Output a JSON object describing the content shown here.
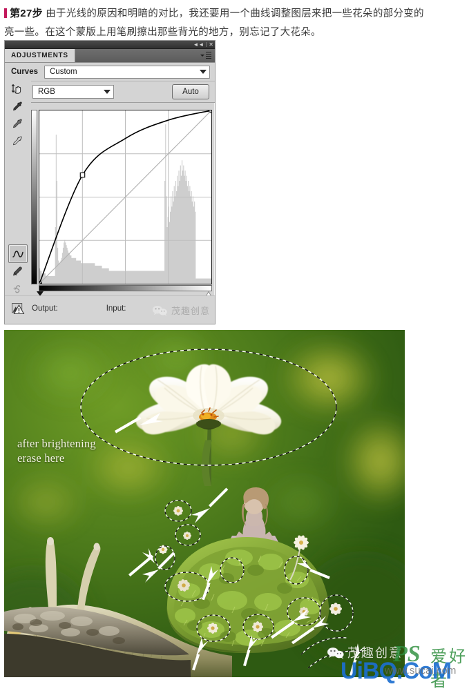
{
  "tutorial": {
    "step_label": "第27步",
    "line1": "由于光线的原因和明暗的对比，我还要用一个曲线调整图层来把一些花朵的部分变的",
    "line2": "亮一些。在这个蒙版上用笔刷擦出那些背光的地方，别忘记了大花朵。"
  },
  "panel": {
    "titlebar": {
      "collapse": "◄◄",
      "close": "✕"
    },
    "tab_label": "ADJUSTMENTS",
    "curves_label": "Curves",
    "preset_value": "Custom",
    "channel_value": "RGB",
    "auto_label": "Auto",
    "output_label": "Output:",
    "input_label": "Input:",
    "output_value": "",
    "input_value": "",
    "watermark": "茂趣创意",
    "tools": [
      {
        "name": "targeted-adjustment-tool",
        "selected": false
      },
      {
        "name": "black-point-eyedropper",
        "selected": false
      },
      {
        "name": "gray-point-eyedropper",
        "selected": false
      },
      {
        "name": "white-point-eyedropper",
        "selected": false
      },
      {
        "name": "curve-point-tool",
        "selected": true
      },
      {
        "name": "pencil-draw-tool",
        "selected": false
      },
      {
        "name": "smooth-curve-tool",
        "selected": false
      }
    ]
  },
  "chart_data": {
    "type": "line",
    "title": "RGB Curve",
    "xlabel": "Input",
    "ylabel": "Output",
    "xlim": [
      0,
      255
    ],
    "ylim": [
      0,
      255
    ],
    "grid": true,
    "grid_divisions": 4,
    "series": [
      {
        "name": "RGB curve",
        "points": [
          [
            0,
            0
          ],
          [
            64,
            160
          ],
          [
            128,
            214
          ],
          [
            192,
            241
          ],
          [
            255,
            255
          ]
        ],
        "control_points": [
          [
            0,
            0
          ],
          [
            64,
            160
          ],
          [
            255,
            255
          ]
        ],
        "color": "#000000"
      },
      {
        "name": "baseline diagonal",
        "points": [
          [
            0,
            0
          ],
          [
            255,
            255
          ]
        ],
        "color": "#b4b4b4"
      }
    ],
    "histogram": {
      "name": "image histogram",
      "color": "#c9c9c9",
      "bins": [
        6,
        5,
        5,
        4,
        4,
        4,
        4,
        4,
        3,
        3,
        3,
        3,
        3,
        3,
        3,
        3,
        3,
        3,
        3,
        3,
        22,
        58,
        40,
        14,
        9,
        8,
        8,
        9,
        10,
        12,
        14,
        16,
        17,
        16,
        15,
        14,
        13,
        12,
        12,
        11,
        11,
        10,
        10,
        10,
        10,
        10,
        10,
        9,
        9,
        9,
        9,
        9,
        9,
        8,
        8,
        8,
        8,
        8,
        8,
        8,
        8,
        8,
        8,
        8,
        8,
        8,
        8,
        8,
        8,
        8,
        8,
        7,
        7,
        7,
        7,
        7,
        7,
        7,
        7,
        7,
        6,
        6,
        6,
        6,
        6,
        6,
        6,
        6,
        6,
        5,
        5,
        5,
        5,
        5,
        5,
        5,
        5,
        5,
        5,
        5,
        5,
        5,
        5,
        5,
        5,
        5,
        5,
        5,
        5,
        5,
        5,
        5,
        5,
        5,
        5,
        5,
        5,
        5,
        5,
        5,
        5,
        5,
        5,
        5,
        5,
        5,
        5,
        5,
        5,
        5,
        5,
        5,
        5,
        5,
        5,
        5,
        5,
        5,
        5,
        5,
        5,
        5,
        5,
        5,
        5,
        5,
        5,
        5,
        5,
        5,
        5,
        5,
        5,
        5,
        5,
        5,
        5,
        5,
        5,
        5,
        40,
        62,
        34,
        22,
        26,
        30,
        24,
        28,
        34,
        30,
        36,
        32,
        38,
        34,
        40,
        36,
        42,
        38,
        44,
        40,
        46,
        42,
        48,
        44,
        46,
        42,
        44,
        40,
        42,
        38,
        40,
        36,
        38,
        34,
        36,
        32,
        34,
        30,
        32,
        28,
        2,
        2,
        2,
        2,
        2,
        2,
        2,
        2,
        2,
        2,
        2,
        2,
        2,
        2,
        2,
        2,
        2,
        2,
        2,
        2
      ]
    }
  },
  "photo": {
    "annotations": [
      {
        "name": "brighten-note-line1",
        "text": "after brightening"
      },
      {
        "name": "brighten-note-line2",
        "text": "erase here"
      }
    ],
    "subjects": [
      "large white cosmos flower",
      "snail with mossy shell",
      "little girl in tulle dress",
      "small white daisies",
      "dashed selection ellipses",
      "white pointer arrows",
      "rock branch"
    ],
    "colors": {
      "background_green": "#4d7a1e",
      "background_olive": "#8d9a28",
      "flower_white": "#f4f1e2",
      "snail_body": "#b8ad8a",
      "moss_green": "#7e9a36",
      "dress_mauve": "#c4adb4"
    }
  },
  "watermarks": {
    "wechat_name": "茂趣创意",
    "ps_mark": "PS",
    "ps_cn": "爱好者",
    "site": "UiBQ.CoM",
    "site_url": "www.sucai.com"
  }
}
